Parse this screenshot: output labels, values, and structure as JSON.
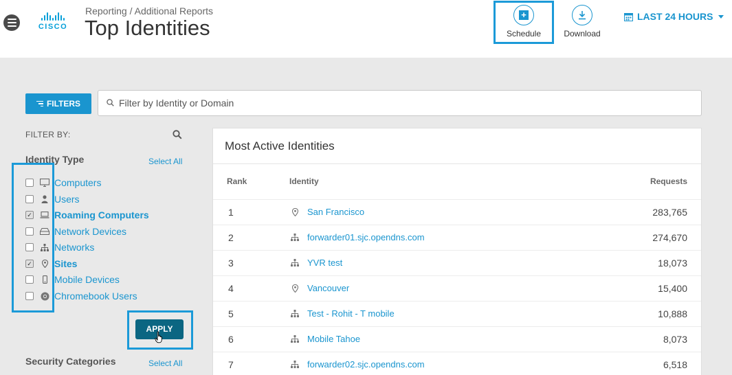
{
  "header": {
    "breadcrumb": "Reporting / Additional Reports",
    "title": "Top Identities",
    "logo_text": "CISCO",
    "actions": {
      "schedule_label": "Schedule",
      "download_label": "Download"
    },
    "time_range": "LAST 24 HOURS"
  },
  "toolbar": {
    "filters_label": "FILTERS",
    "search_placeholder": "Filter by Identity or Domain",
    "search_value": ""
  },
  "filter_panel": {
    "filter_by_label": "FILTER BY:",
    "identity_type": {
      "title": "Identity Type",
      "select_all": "Select All",
      "items": [
        {
          "label": "Computers",
          "icon": "monitor-icon",
          "checked": false
        },
        {
          "label": "Users",
          "icon": "user-icon",
          "checked": false
        },
        {
          "label": "Roaming Computers",
          "icon": "laptop-icon",
          "checked": true
        },
        {
          "label": "Network Devices",
          "icon": "router-icon",
          "checked": false
        },
        {
          "label": "Networks",
          "icon": "network-icon",
          "checked": false
        },
        {
          "label": "Sites",
          "icon": "map-pin-icon",
          "checked": true
        },
        {
          "label": "Mobile Devices",
          "icon": "mobile-icon",
          "checked": false
        },
        {
          "label": "Chromebook Users",
          "icon": "chrome-icon",
          "checked": false
        }
      ]
    },
    "apply_label": "APPLY",
    "security_categories": {
      "title": "Security Categories",
      "select_all": "Select All"
    }
  },
  "card": {
    "title": "Most Active Identities",
    "columns": {
      "rank": "Rank",
      "identity": "Identity",
      "requests": "Requests"
    },
    "rows": [
      {
        "rank": "1",
        "identity": "San Francisco",
        "icon": "map-pin-icon",
        "requests": "283,765"
      },
      {
        "rank": "2",
        "identity": "forwarder01.sjc.opendns.com",
        "icon": "network-icon",
        "requests": "274,670"
      },
      {
        "rank": "3",
        "identity": "YVR test",
        "icon": "network-icon",
        "requests": "18,073"
      },
      {
        "rank": "4",
        "identity": "Vancouver",
        "icon": "map-pin-icon",
        "requests": "15,400"
      },
      {
        "rank": "5",
        "identity": "Test - Rohit - T mobile",
        "icon": "network-icon",
        "requests": "10,888"
      },
      {
        "rank": "6",
        "identity": "Mobile Tahoe",
        "icon": "network-icon",
        "requests": "8,073"
      },
      {
        "rank": "7",
        "identity": "forwarder02.sjc.opendns.com",
        "icon": "network-icon",
        "requests": "6,518"
      }
    ]
  },
  "colors": {
    "accent": "#1a95cf",
    "apply_button": "#0b6682",
    "highlight_box": "#1b9ad8"
  }
}
